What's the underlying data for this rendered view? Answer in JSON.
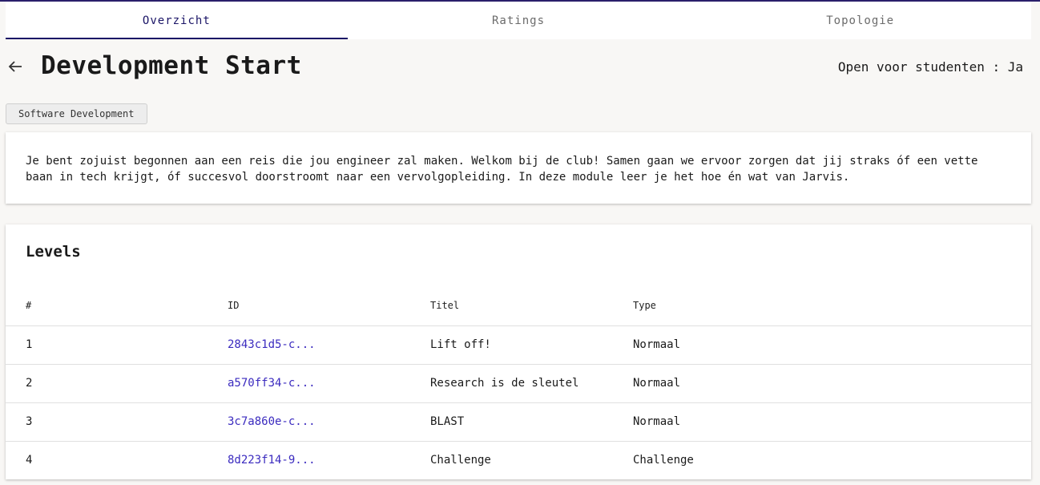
{
  "tabs": [
    {
      "label": "Overzicht",
      "active": true
    },
    {
      "label": "Ratings",
      "active": false
    },
    {
      "label": "Topologie",
      "active": false
    }
  ],
  "header": {
    "title": "Development Start",
    "open_status": "Open voor studenten : Ja",
    "back_icon": "arrow-left-icon"
  },
  "tag": "Software Development",
  "description": "Je bent zojuist begonnen aan een reis die jou engineer zal maken. Welkom bij de club! Samen gaan we ervoor zorgen dat jij straks óf een vette baan in tech krijgt, óf succesvol doorstroomt naar een vervolgopleiding. In deze module leer je het hoe én wat van Jarvis.",
  "levels": {
    "heading": "Levels",
    "columns": [
      "#",
      "ID",
      "Titel",
      "Type"
    ],
    "rows": [
      {
        "num": "1",
        "id": "2843c1d5-c...",
        "title": "Lift off!",
        "type": "Normaal"
      },
      {
        "num": "2",
        "id": "a570ff34-c...",
        "title": "Research is de sleutel",
        "type": "Normaal"
      },
      {
        "num": "3",
        "id": "3c7a860e-c...",
        "title": "BLAST",
        "type": "Normaal"
      },
      {
        "num": "4",
        "id": "8d223f14-9...",
        "title": "Challenge",
        "type": "Challenge"
      }
    ]
  },
  "colors": {
    "accent": "#1a1466",
    "link": "#3b2bbf"
  }
}
